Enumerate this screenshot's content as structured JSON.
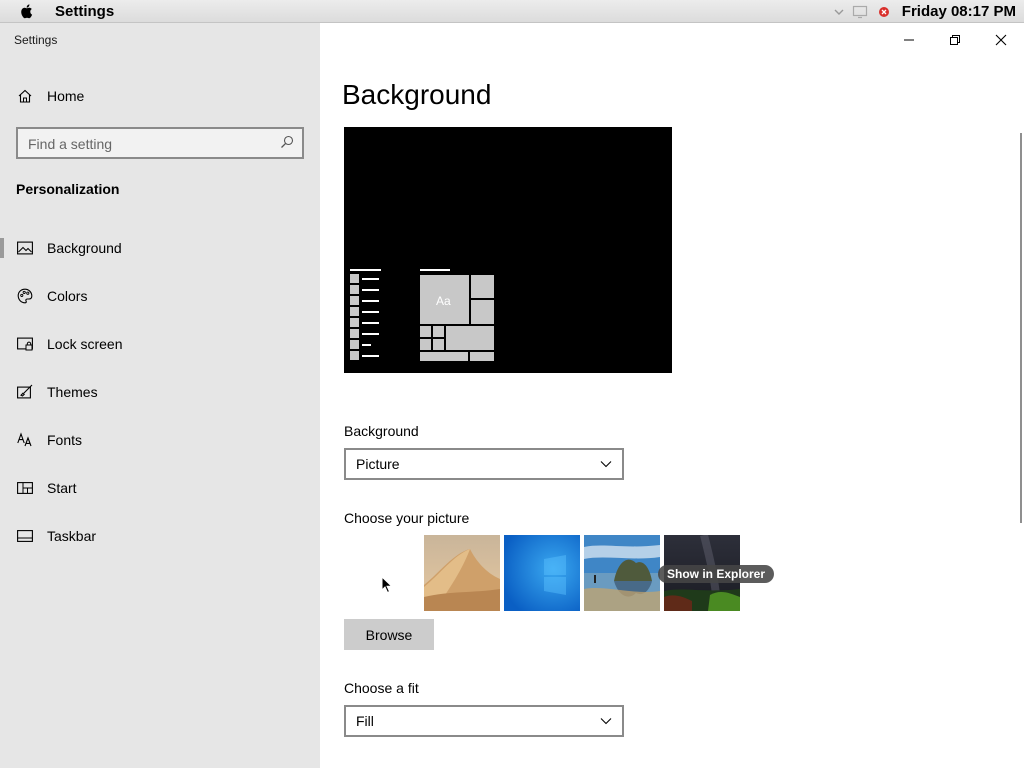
{
  "menubar": {
    "app_name": "Settings",
    "clock": "Friday 08:17 PM"
  },
  "sidebar": {
    "window_title": "Settings",
    "home_label": "Home",
    "search_placeholder": "Find a setting",
    "section_heading": "Personalization",
    "items": [
      {
        "label": "Background",
        "icon": "picture-icon",
        "active": true
      },
      {
        "label": "Colors",
        "icon": "palette-icon"
      },
      {
        "label": "Lock screen",
        "icon": "lock-screen-icon"
      },
      {
        "label": "Themes",
        "icon": "brush-icon"
      },
      {
        "label": "Fonts",
        "icon": "fonts-icon"
      },
      {
        "label": "Start",
        "icon": "start-icon"
      },
      {
        "label": "Taskbar",
        "icon": "taskbar-icon"
      }
    ]
  },
  "main": {
    "title": "Background",
    "preview_tile_text": "Aa",
    "background_label": "Background",
    "background_value": "Picture",
    "choose_picture_label": "Choose your picture",
    "thumbnails": [
      "desert-dunes",
      "windows-blue",
      "beach-rocks",
      "night-sky"
    ],
    "tooltip": "Show in Explorer",
    "browse_label": "Browse",
    "fit_label": "Choose a fit",
    "fit_value": "Fill"
  }
}
